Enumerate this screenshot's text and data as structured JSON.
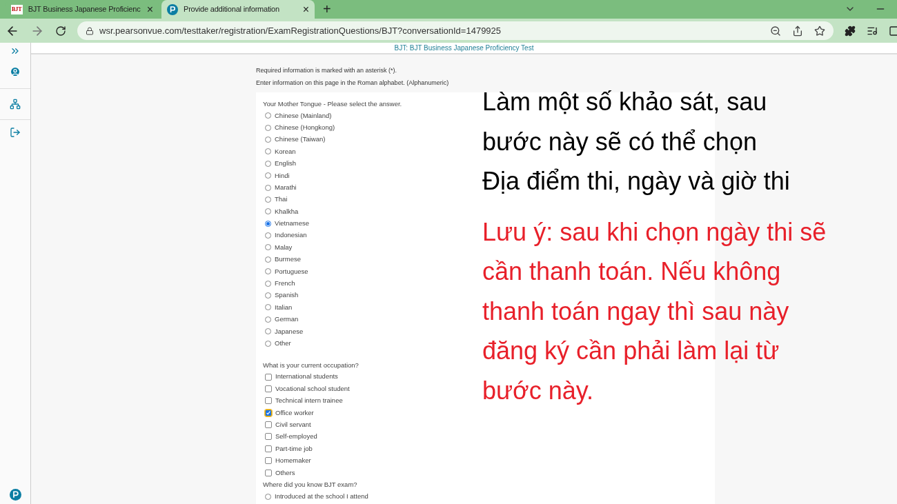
{
  "browser": {
    "tabs": [
      {
        "title": "BJT Business Japanese Proficienc",
        "selected": false,
        "kind": "bjt",
        "close": "×"
      },
      {
        "title": "Provide additional information",
        "selected": true,
        "kind": "pearson",
        "close": "×"
      }
    ],
    "new_tab": "+",
    "url": "wsr.pearsonvue.com/testtaker/registration/ExamRegistrationQuestions/BJT?conversationId=1479925",
    "bjt_logo": "BJT"
  },
  "header": {
    "title": "BJT: BJT Business Japanese Proficiency Test"
  },
  "notes": [
    "Required information is marked with an asterisk (*).",
    "Enter information on this page in the Roman alphabet. (Alphanumeric)"
  ],
  "questions": [
    {
      "kind": "radio",
      "label": "Your Mother Tongue - Please select the answer.",
      "options": [
        {
          "label": "Chinese (Mainland)",
          "selected": false
        },
        {
          "label": "Chinese (Hongkong)",
          "selected": false
        },
        {
          "label": "Chinese (Taiwan)",
          "selected": false
        },
        {
          "label": "Korean",
          "selected": false
        },
        {
          "label": "English",
          "selected": false
        },
        {
          "label": "Hindi",
          "selected": false
        },
        {
          "label": "Marathi",
          "selected": false
        },
        {
          "label": "Thai",
          "selected": false
        },
        {
          "label": "Khalkha",
          "selected": false
        },
        {
          "label": "Vietnamese",
          "selected": true
        },
        {
          "label": "Indonesian",
          "selected": false
        },
        {
          "label": "Malay",
          "selected": false
        },
        {
          "label": "Burmese",
          "selected": false
        },
        {
          "label": "Portuguese",
          "selected": false
        },
        {
          "label": "French",
          "selected": false
        },
        {
          "label": "Spanish",
          "selected": false
        },
        {
          "label": "Italian",
          "selected": false
        },
        {
          "label": "German",
          "selected": false
        },
        {
          "label": "Japanese",
          "selected": false
        },
        {
          "label": "Other",
          "selected": false
        }
      ]
    },
    {
      "kind": "checkbox",
      "label": "What is your current occupation?",
      "options": [
        {
          "label": "International students",
          "checked": false
        },
        {
          "label": "Vocational school student",
          "checked": false
        },
        {
          "label": "Technical intern trainee",
          "checked": false
        },
        {
          "label": "Office worker",
          "checked": true
        },
        {
          "label": "Civil servant",
          "checked": false
        },
        {
          "label": "Self-employed",
          "checked": false
        },
        {
          "label": "Part-time job",
          "checked": false
        },
        {
          "label": "Homemaker",
          "checked": false
        },
        {
          "label": "Others",
          "checked": false
        }
      ]
    },
    {
      "kind": "radio",
      "label": "Where did you know BJT exam?",
      "options": [
        {
          "label": "Introduced at the school I attend",
          "selected": false
        }
      ]
    }
  ],
  "annotation": {
    "instruction": "Làm một số khảo sát, sau bước này sẽ có thể chọn Địa điểm thi, ngày và giờ thi",
    "warning": "Lưu ý: sau khi chọn ngày thi sẽ cần thanh toán. Nếu không thanh toán ngay thì sau này đăng ký cần phải làm lại từ bước này."
  }
}
